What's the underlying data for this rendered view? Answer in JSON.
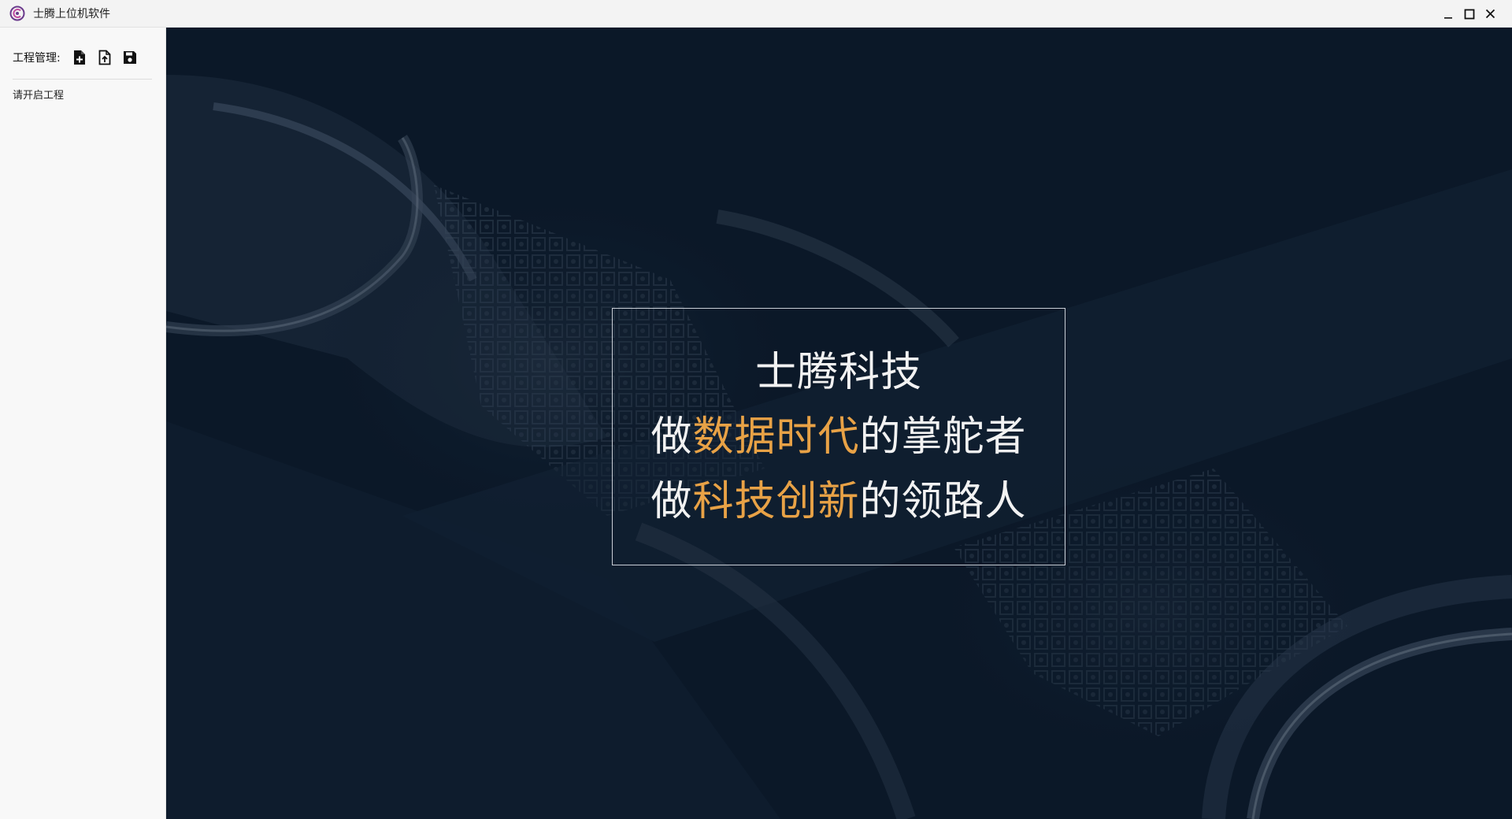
{
  "window": {
    "title": "士腾上位机软件",
    "logo_icon": "app-logo-icon",
    "controls": [
      "minimize-icon",
      "maximize-icon",
      "close-icon"
    ]
  },
  "sidebar": {
    "project_label": "工程管理:",
    "project_actions": [
      {
        "name": "new-project",
        "icon": "file-plus-icon"
      },
      {
        "name": "open-project",
        "icon": "file-upload-icon"
      },
      {
        "name": "save-project",
        "icon": "save-icon"
      }
    ],
    "open_hint": "请开启工程"
  },
  "hero": {
    "line1": "士腾科技",
    "line2": {
      "prefix": "做",
      "highlight": "数据时代",
      "suffix": "的掌舵者"
    },
    "line3": {
      "prefix": "做",
      "highlight": "科技创新",
      "suffix": "的领路人"
    }
  },
  "colors": {
    "hero_background": "#0b1929",
    "accent": "#e8a246",
    "slogan_text": "#f2f2f2",
    "frame_border": "#c9ced6"
  }
}
